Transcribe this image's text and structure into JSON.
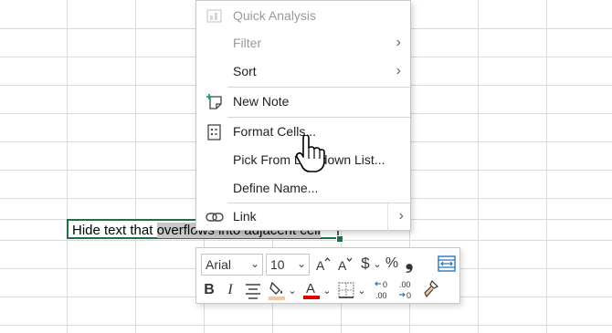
{
  "menu": {
    "quick_analysis": "Quick Analysis",
    "filter": "Filter",
    "sort": "Sort",
    "new_note": "New Note",
    "format_cells": "Format Cells...",
    "pick_from_list_a": "Pick From D",
    "pick_from_list_b": "-down List...",
    "define_name": "Define Name...",
    "link": "Link"
  },
  "cell": {
    "text_plain": "Hide text that ",
    "text_selected": "overflows into adjacent cell"
  },
  "toolbar": {
    "font": "Arial",
    "size": "10",
    "currency": "$",
    "percent": "%",
    "comma": "❟",
    "bold": "B",
    "italic": "I",
    "font_color_letter": "A",
    "increase_decimal": "←0 .00",
    "decrease_decimal": ".00 →0"
  },
  "colors": {
    "grid": "#dadada",
    "selection_border": "#1e7145",
    "highlight": "#f4c7a1",
    "font_color": "#e00000",
    "accent_blue": "#2e75b6"
  }
}
